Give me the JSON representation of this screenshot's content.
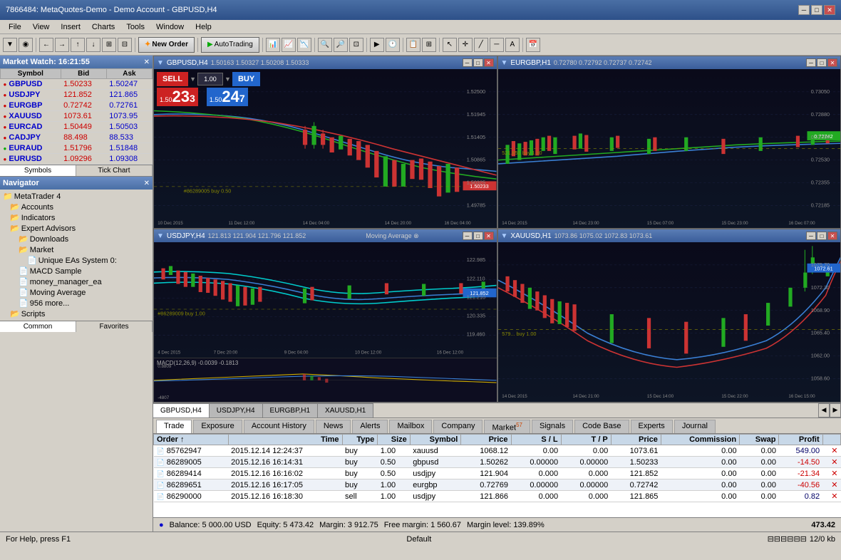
{
  "titlebar": {
    "text": "7866484: MetaQuotes-Demo - Demo Account - GBPUSD,H4",
    "min": "─",
    "max": "□",
    "close": "✕"
  },
  "menu": {
    "items": [
      "File",
      "View",
      "Insert",
      "Charts",
      "Tools",
      "Window",
      "Help"
    ]
  },
  "toolbar": {
    "new_order": "New Order",
    "auto_trading": "AutoTrading"
  },
  "market_watch": {
    "title": "Market Watch: 16:21:55",
    "columns": [
      "Symbol",
      "Bid",
      "Ask"
    ],
    "rows": [
      {
        "symbol": "GBPUSD",
        "bid": "1.50233",
        "ask": "1.50247",
        "dot": "red"
      },
      {
        "symbol": "USDJPY",
        "bid": "121.852",
        "ask": "121.865",
        "dot": "red"
      },
      {
        "symbol": "EURGBP",
        "bid": "0.72742",
        "ask": "0.72761",
        "dot": "red"
      },
      {
        "symbol": "XAUUSD",
        "bid": "1073.61",
        "ask": "1073.95",
        "dot": "red"
      },
      {
        "symbol": "EURCAD",
        "bid": "1.50449",
        "ask": "1.50503",
        "dot": "red"
      },
      {
        "symbol": "CADJPY",
        "bid": "88.498",
        "ask": "88.533",
        "dot": "red"
      },
      {
        "symbol": "EURAUD",
        "bid": "1.51796",
        "ask": "1.51848",
        "dot": "green"
      },
      {
        "symbol": "EURUSD",
        "bid": "1.09296",
        "ask": "1.09308",
        "dot": "red"
      }
    ],
    "tabs": [
      "Symbols",
      "Tick Chart"
    ]
  },
  "navigator": {
    "title": "Navigator",
    "tree": [
      {
        "label": "MetaTrader 4",
        "indent": 0,
        "type": "root"
      },
      {
        "label": "Accounts",
        "indent": 1,
        "type": "folder"
      },
      {
        "label": "Indicators",
        "indent": 1,
        "type": "folder"
      },
      {
        "label": "Expert Advisors",
        "indent": 1,
        "type": "folder"
      },
      {
        "label": "Downloads",
        "indent": 2,
        "type": "folder"
      },
      {
        "label": "Market",
        "indent": 2,
        "type": "folder"
      },
      {
        "label": "Unique EAs System 0:",
        "indent": 3,
        "type": "item"
      },
      {
        "label": "MACD Sample",
        "indent": 2,
        "type": "item"
      },
      {
        "label": "money_manager_ea",
        "indent": 2,
        "type": "item"
      },
      {
        "label": "Moving Average",
        "indent": 2,
        "type": "item"
      },
      {
        "label": "956 more...",
        "indent": 2,
        "type": "item"
      },
      {
        "label": "Scripts",
        "indent": 1,
        "type": "folder"
      }
    ],
    "tabs": [
      "Common",
      "Favorites"
    ]
  },
  "charts": {
    "gbpusd": {
      "title": "GBPUSD,H4",
      "ohlc": "1.50163 1.50327 1.50208 1.50333",
      "sell_price_int": "1.50",
      "sell_price_big": "23",
      "sell_price_sup": "3",
      "buy_price_int": "1.50",
      "buy_price_big": "24",
      "buy_price_sup": "7",
      "lot": "1.00",
      "annotation": "#86289005 buy 0.50",
      "price_label": "1.50233"
    },
    "eurgbp": {
      "title": "EURGBP,H1",
      "ohlc": "0.72780 0.72792 0.72737 0.72742",
      "annotation": "521.651 buy 1.00",
      "price_label": "0.72742"
    },
    "usdjpy": {
      "title": "USDJPY,H4",
      "ohlc": "121.813 121.904 121.796 121.852",
      "indicator": "Moving Average ⊗",
      "annotation": "#86289009 buy 1.00",
      "macd": "MACD(12,26,9) -0.0039 -0.1813",
      "price_label": "121.852"
    },
    "xauusd": {
      "title": "XAUUSD,H1",
      "ohlc": "1073.86 1075.02 1072.83 1073.61",
      "annotation": "579... buy 1.00",
      "price_label": "1072.61"
    }
  },
  "chart_tabs": {
    "tabs": [
      "GBPUSD,H4",
      "USDJPY,H4",
      "EURGBP,H1",
      "XAUUSD,H1"
    ],
    "active": "GBPUSD,H4"
  },
  "terminal": {
    "tabs": [
      "Trade",
      "Exposure",
      "Account History",
      "News",
      "Alerts",
      "Mailbox",
      "Company",
      "Market",
      "Signals",
      "Code Base",
      "Experts",
      "Journal"
    ],
    "market_badge": "57",
    "active_tab": "Trade",
    "columns": [
      "Order",
      "↑",
      "Time",
      "Type",
      "Size",
      "Symbol",
      "Price",
      "S / L",
      "T / P",
      "Price",
      "Commission",
      "Swap",
      "Profit"
    ],
    "orders": [
      {
        "order": "85762947",
        "time": "2015.12.14 12:24:37",
        "type": "buy",
        "size": "1.00",
        "symbol": "xauusd",
        "open_price": "1068.12",
        "sl": "0.00",
        "tp": "0.00",
        "price": "1073.61",
        "commission": "0.00",
        "swap": "0.00",
        "profit": "549.00"
      },
      {
        "order": "86289005",
        "time": "2015.12.16 16:14:31",
        "type": "buy",
        "size": "0.50",
        "symbol": "gbpusd",
        "open_price": "1.50262",
        "sl": "0.00000",
        "tp": "0.00000",
        "price": "1.50233",
        "commission": "0.00",
        "swap": "0.00",
        "profit": "-14.50"
      },
      {
        "order": "86289414",
        "time": "2015.12.16 16:16:02",
        "type": "buy",
        "size": "0.50",
        "symbol": "usdjpy",
        "open_price": "121.904",
        "sl": "0.000",
        "tp": "0.000",
        "price": "121.852",
        "commission": "0.00",
        "swap": "0.00",
        "profit": "-21.34"
      },
      {
        "order": "86289651",
        "time": "2015.12.16 16:17:05",
        "type": "buy",
        "size": "1.00",
        "symbol": "eurgbp",
        "open_price": "0.72769",
        "sl": "0.00000",
        "tp": "0.00000",
        "price": "0.72742",
        "commission": "0.00",
        "swap": "0.00",
        "profit": "-40.56"
      },
      {
        "order": "86290000",
        "time": "2015.12.16 16:18:30",
        "type": "sell",
        "size": "1.00",
        "symbol": "usdjpy",
        "open_price": "121.866",
        "sl": "0.000",
        "tp": "0.000",
        "price": "121.865",
        "commission": "0.00",
        "swap": "0.00",
        "profit": "0.82"
      }
    ]
  },
  "status": {
    "balance_label": "Balance:",
    "balance": "5 000.00 USD",
    "equity_label": "Equity:",
    "equity": "5 473.42",
    "margin_label": "Margin:",
    "margin": "3 912.75",
    "free_margin_label": "Free margin:",
    "free_margin": "1 560.67",
    "margin_level_label": "Margin level:",
    "margin_level": "139.89%",
    "profit": "473.42"
  },
  "bottombar": {
    "left": "For Help, press F1",
    "center": "Default",
    "right": "12/0 kb"
  }
}
